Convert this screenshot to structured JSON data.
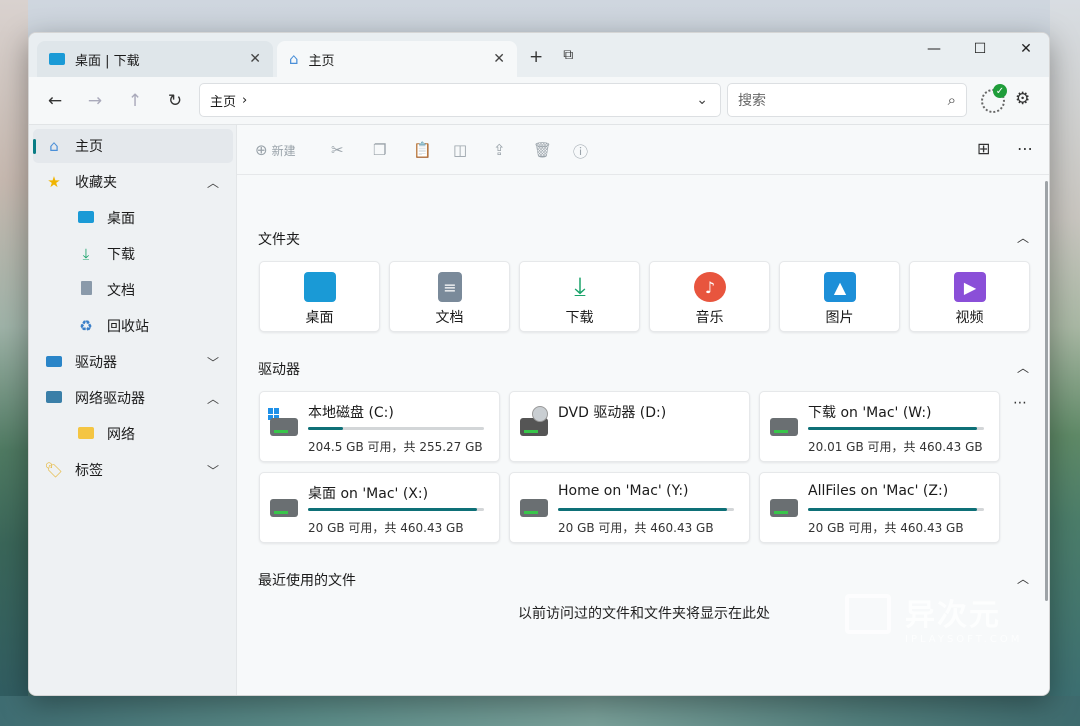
{
  "tabs": [
    {
      "label": "桌面 | 下载",
      "icon": "desktop-icon"
    },
    {
      "label": "主页",
      "icon": "home-icon"
    }
  ],
  "tab_actions": {
    "new_tab": "+",
    "duplicate": "⧉"
  },
  "window_controls": {
    "minimize": "—",
    "maximize": "☐",
    "close": "✕"
  },
  "address": {
    "path": "主页",
    "separator": "›"
  },
  "search": {
    "placeholder": "搜索"
  },
  "sidebar": {
    "items": [
      {
        "label": "主页",
        "icon": "home-icon",
        "selected": true
      },
      {
        "label": "收藏夹",
        "icon": "star-icon",
        "chevron": "^"
      },
      {
        "label": "桌面",
        "icon": "desktop-icon"
      },
      {
        "label": "下载",
        "icon": "download-icon"
      },
      {
        "label": "文档",
        "icon": "document-icon"
      },
      {
        "label": "回收站",
        "icon": "recycle-bin-icon"
      },
      {
        "label": "驱动器",
        "icon": "monitor-icon",
        "chevron": "v"
      },
      {
        "label": "网络驱动器",
        "icon": "network-drive-icon",
        "chevron": "^"
      },
      {
        "label": "网络",
        "icon": "folder-icon"
      },
      {
        "label": "标签",
        "icon": "tag-icon",
        "chevron": "v"
      }
    ]
  },
  "toolbar": {
    "new_label": "新建"
  },
  "sections": {
    "folders": "文件夹",
    "drives": "驱动器",
    "recent": "最近使用的文件"
  },
  "folders": [
    {
      "label": "桌面",
      "icon": "desktop-icon",
      "color": "#1a9ad6"
    },
    {
      "label": "文档",
      "icon": "document-icon",
      "color": "#7a8a9a"
    },
    {
      "label": "下载",
      "icon": "download-icon",
      "color": "#1aa36a"
    },
    {
      "label": "音乐",
      "icon": "music-icon",
      "color": "#e8553e"
    },
    {
      "label": "图片",
      "icon": "picture-icon",
      "color": "#1d8fd8"
    },
    {
      "label": "视频",
      "icon": "video-icon",
      "color": "#8a4fd8"
    }
  ],
  "drives": [
    {
      "name": "本地磁盘 (C:)",
      "info": "204.5 GB 可用，共 255.27 GB",
      "used_fraction": 0.2
    },
    {
      "name": "DVD 驱动器 (D:)",
      "info": "",
      "used_fraction": 0
    },
    {
      "name": "下载 on 'Mac' (W:)",
      "info": "20.01 GB 可用，共 460.43 GB",
      "used_fraction": 0.96
    },
    {
      "name": "桌面 on 'Mac' (X:)",
      "info": "20 GB 可用，共 460.43 GB",
      "used_fraction": 0.96
    },
    {
      "name": "Home on 'Mac' (Y:)",
      "info": "20 GB 可用，共 460.43 GB",
      "used_fraction": 0.96
    },
    {
      "name": "AllFiles on 'Mac' (Z:)",
      "info": "20 GB 可用，共 460.43 GB",
      "used_fraction": 0.96
    }
  ],
  "recent": {
    "empty_message": "以前访问过的文件和文件夹将显示在此处"
  },
  "watermark": {
    "brand": "异次元",
    "site": "IPLAYSOFT.COM"
  },
  "colors": {
    "accent": "#0e7077",
    "selection": "#e4e8ec"
  }
}
